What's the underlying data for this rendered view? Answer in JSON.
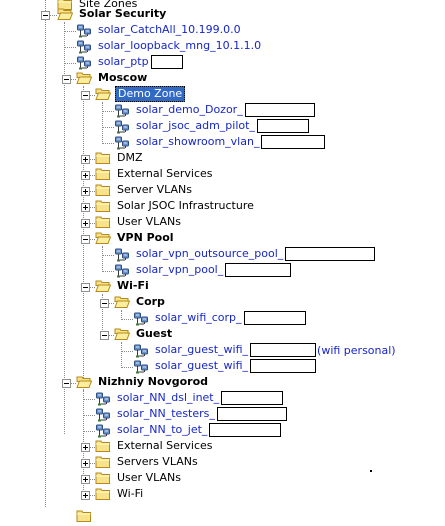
{
  "tree": {
    "top_clipped_label": "Site Zones",
    "bottom_clipped_label": "",
    "rows": [
      {
        "label": "Solar Security",
        "kind": "folder-open",
        "style": "bold",
        "expander": "minus",
        "level": 0
      },
      {
        "label": "solar_CatchAll_10.199.0.0",
        "kind": "server",
        "style": "link",
        "expander": "",
        "level": 1
      },
      {
        "label": "solar_loopback_mng_10.1.1.0",
        "kind": "server",
        "style": "link",
        "expander": "",
        "level": 1
      },
      {
        "label": "solar_ptp",
        "kind": "server",
        "style": "link",
        "expander": "",
        "level": 1,
        "redaction": true
      },
      {
        "label": "Moscow",
        "kind": "folder-open",
        "style": "bold",
        "expander": "minus",
        "level": 1
      },
      {
        "label": "Demo Zone",
        "kind": "folder-open",
        "style": "selected",
        "expander": "minus",
        "level": 2
      },
      {
        "label": "solar_demo_Dozor_",
        "kind": "server",
        "style": "link",
        "expander": "",
        "level": 3,
        "redaction": true
      },
      {
        "label": "solar_jsoc_adm_pilot_",
        "kind": "server",
        "style": "link",
        "expander": "",
        "level": 3,
        "redaction": true
      },
      {
        "label": "solar_showroom_vlan_",
        "kind": "server",
        "style": "link",
        "expander": "",
        "level": 3,
        "redaction": true
      },
      {
        "label": "DMZ",
        "kind": "folder-closed",
        "style": "normal",
        "expander": "plus",
        "level": 2
      },
      {
        "label": "External Services",
        "kind": "folder-closed",
        "style": "normal",
        "expander": "plus",
        "level": 2
      },
      {
        "label": "Server VLANs",
        "kind": "folder-closed",
        "style": "normal",
        "expander": "plus",
        "level": 2
      },
      {
        "label": "Solar JSOC Infrastructure",
        "kind": "folder-closed",
        "style": "normal",
        "expander": "plus",
        "level": 2
      },
      {
        "label": "User VLANs",
        "kind": "folder-closed",
        "style": "normal",
        "expander": "plus",
        "level": 2
      },
      {
        "label": "VPN Pool",
        "kind": "folder-open",
        "style": "bold",
        "expander": "minus",
        "level": 2
      },
      {
        "label": "solar_vpn_outsource_pool_",
        "kind": "server",
        "style": "link",
        "expander": "",
        "level": 3,
        "redaction": true
      },
      {
        "label": "solar_vpn_pool_",
        "kind": "server",
        "style": "link",
        "expander": "",
        "level": 3,
        "redaction": true
      },
      {
        "label": "Wi-Fi",
        "kind": "folder-open",
        "style": "bold",
        "expander": "minus",
        "level": 2
      },
      {
        "label": "Corp",
        "kind": "folder-open",
        "style": "bold",
        "expander": "minus",
        "level": 3
      },
      {
        "label": "solar_wifi_corp_",
        "kind": "server",
        "style": "link",
        "expander": "",
        "level": 4,
        "redaction": true
      },
      {
        "label": "Guest",
        "kind": "folder-open",
        "style": "bold",
        "expander": "minus",
        "level": 3
      },
      {
        "label": "solar_guest_wifi_",
        "kind": "server",
        "style": "link",
        "expander": "",
        "level": 4,
        "redaction": true,
        "suffix": "(wifi personal)"
      },
      {
        "label": "solar_guest_wifi_",
        "kind": "server",
        "style": "link",
        "expander": "",
        "level": 4,
        "redaction": true
      },
      {
        "label": "Nizhniy Novgorod",
        "kind": "folder-open",
        "style": "bold",
        "expander": "minus",
        "level": 1
      },
      {
        "label": "solar_NN_dsl_inet_",
        "kind": "server",
        "style": "link",
        "expander": "",
        "level": 2,
        "redaction": true
      },
      {
        "label": "solar_NN_testers_",
        "kind": "server",
        "style": "link",
        "expander": "",
        "level": 2,
        "redaction": true
      },
      {
        "label": "solar_NN_to_jet_",
        "kind": "server",
        "style": "link",
        "expander": "",
        "level": 2,
        "redaction": true
      },
      {
        "label": "External Services",
        "kind": "folder-closed",
        "style": "normal",
        "expander": "plus",
        "level": 2
      },
      {
        "label": "Servers VLANs",
        "kind": "folder-closed",
        "style": "normal",
        "expander": "plus",
        "level": 2
      },
      {
        "label": "User VLANs",
        "kind": "folder-closed",
        "style": "normal",
        "expander": "plus",
        "level": 2
      },
      {
        "label": "Wi-Fi",
        "kind": "folder-closed",
        "style": "normal",
        "expander": "plus",
        "level": 2
      }
    ]
  },
  "colors": {
    "link": "#1626c8",
    "selected_bg": "#316ac5",
    "folder_fill": "#f6e38a",
    "folder_edge": "#b48a1c",
    "server_body": "#6c93c9",
    "connector": "#8a8a8a"
  },
  "icons": {
    "folder-open": "open-folder-icon",
    "folder-closed": "folder-icon",
    "server": "server-network-icon",
    "expander": "tree-expander-icon"
  }
}
